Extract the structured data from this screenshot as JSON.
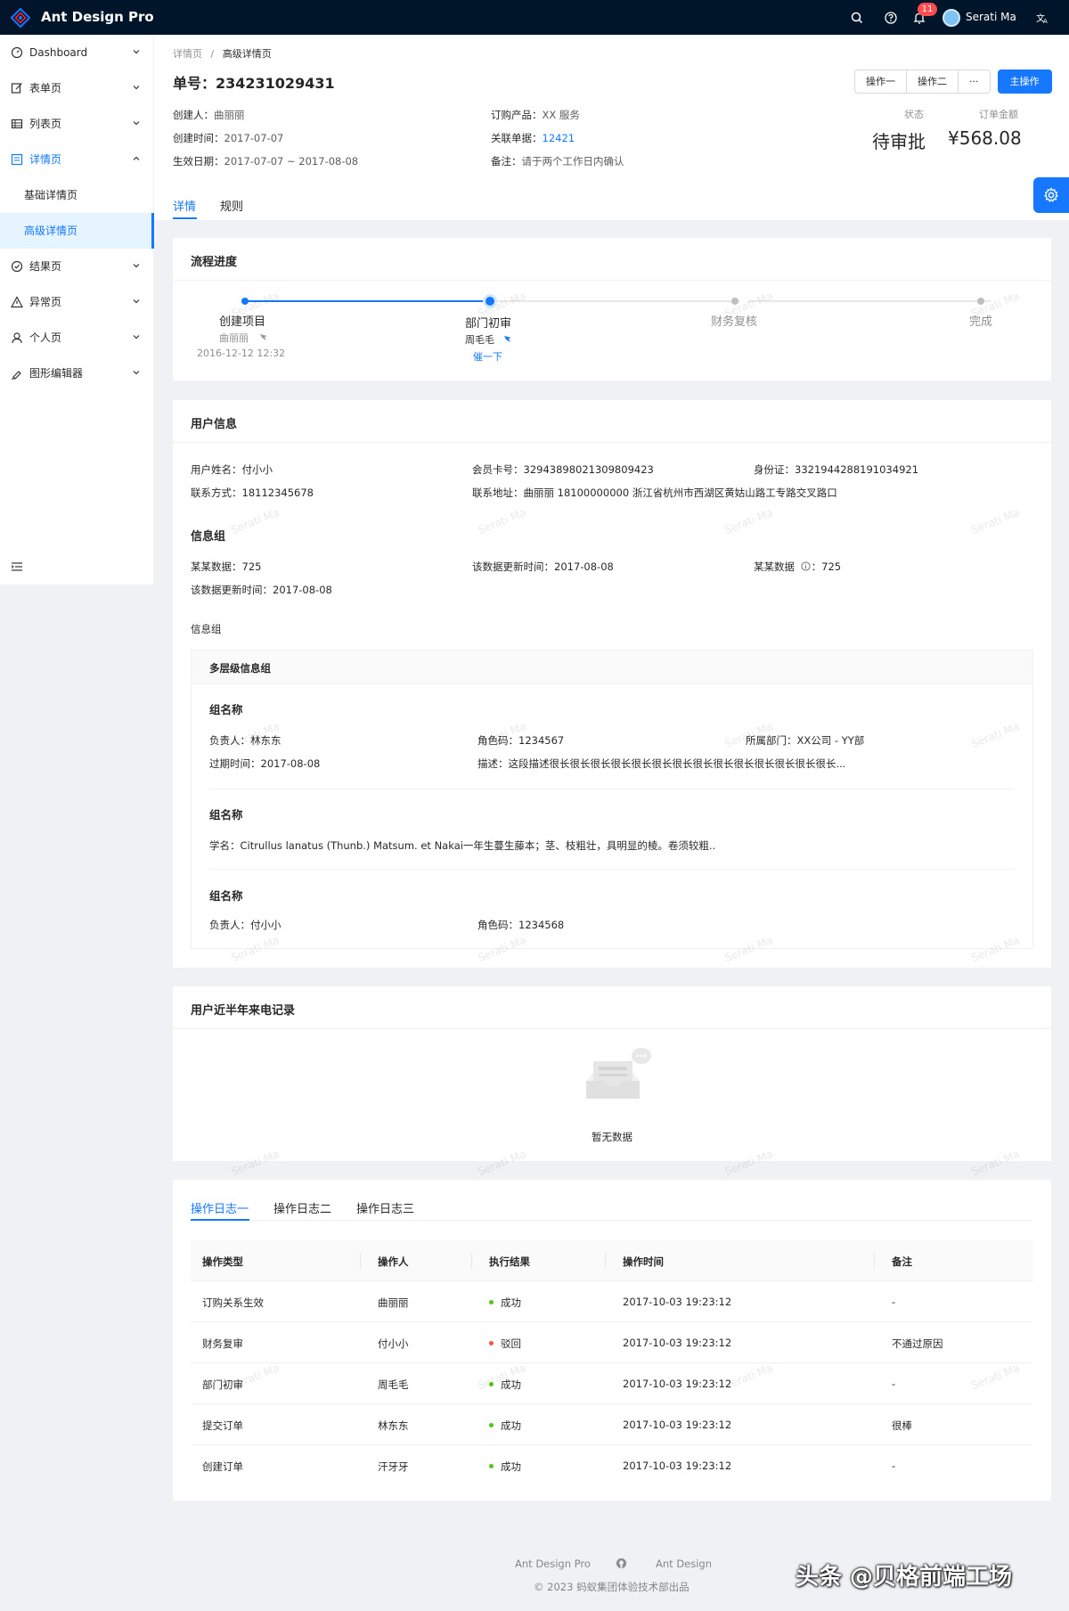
{
  "app": {
    "title": "Ant Design Pro"
  },
  "topbar": {
    "notification_count": "11",
    "username": "Serati Ma"
  },
  "sidebar": {
    "items": [
      {
        "label": "Dashboard"
      },
      {
        "label": "表单页"
      },
      {
        "label": "列表页"
      },
      {
        "label": "详情页"
      },
      {
        "label": "基础详情页"
      },
      {
        "label": "高级详情页"
      },
      {
        "label": "结果页"
      },
      {
        "label": "异常页"
      },
      {
        "label": "个人页"
      },
      {
        "label": "图形编辑器"
      }
    ]
  },
  "breadcrumb": {
    "parent": "详情页",
    "separator": "/",
    "current": "高级详情页"
  },
  "page": {
    "title": "单号：234231029431"
  },
  "actions": {
    "op1": "操作一",
    "op2": "操作二",
    "more": "···",
    "primary": "主操作"
  },
  "header_desc": {
    "creator_k": "创建人：",
    "creator_v": "曲丽丽",
    "product_k": "订购产品：",
    "product_v": "XX 服务",
    "created_k": "创建时间：",
    "created_v": "2017-07-07",
    "ref_k": "关联单据：",
    "ref_v": "12421",
    "effective_k": "生效日期：",
    "effective_v": "2017-07-07 ~ 2017-08-08",
    "note_k": "备注：",
    "note_v": "请于两个工作日内确认"
  },
  "stats": {
    "status_title": "状态",
    "status_value": "待审批",
    "amount_title": "订单金额",
    "amount_value": "¥568.08"
  },
  "tabs": {
    "detail": "详情",
    "rules": "规则"
  },
  "progress": {
    "title": "流程进度",
    "steps": [
      {
        "title": "创建项目",
        "person": "曲丽丽",
        "time": "2016-12-12 12:32"
      },
      {
        "title": "部门初审",
        "person": "周毛毛",
        "action": "催一下"
      },
      {
        "title": "财务复核"
      },
      {
        "title": "完成"
      }
    ]
  },
  "user_info": {
    "title": "用户信息",
    "name_k": "用户姓名：",
    "name_v": "付小小",
    "card_k": "会员卡号：",
    "card_v": "32943898021309809423",
    "id_k": "身份证：",
    "id_v": "3321944288191034921",
    "phone_k": "联系方式：",
    "phone_v": "18112345678",
    "addr_k": "联系地址：",
    "addr_v": "曲丽丽 18100000000 浙江省杭州市西湖区黄姑山路工专路交叉路口",
    "group_title": "信息组",
    "data1_k": "某某数据：",
    "data1_v": "725",
    "upd_k": "该数据更新时间：",
    "upd_v": "2017-08-08",
    "data2_k": "某某数据",
    "data2_v": "725",
    "upd2_k": "该数据更新时间：",
    "upd2_v": "2017-08-08",
    "group2_title": "信息组",
    "multi_title": "多层级信息组",
    "g1_title": "组名称",
    "g1_owner_k": "负责人：",
    "g1_owner_v": "林东东",
    "g1_role_k": "角色码：",
    "g1_role_v": "1234567",
    "g1_dept_k": "所属部门：",
    "g1_dept_v": "XX公司 - YY部",
    "g1_exp_k": "过期时间：",
    "g1_exp_v": "2017-08-08",
    "g1_desc_k": "描述：",
    "g1_desc_v": "这段描述很长很长很长很长很长很长很长很长很长很长很长很长很长很长...",
    "g2_title": "组名称",
    "g2_sci_k": "学名：",
    "g2_sci_v": "Citrullus lanatus (Thunb.) Matsum. et Nakai一年生蔓生藤本；茎、枝粗壮，具明显的棱。卷须较粗..",
    "g3_title": "组名称",
    "g3_owner_k": "负责人：",
    "g3_owner_v": "付小小",
    "g3_role_k": "角色码：",
    "g3_role_v": "1234568"
  },
  "calls": {
    "title": "用户近半年来电记录",
    "empty": "暂无数据"
  },
  "logs": {
    "tabs": [
      "操作日志一",
      "操作日志二",
      "操作日志三"
    ],
    "columns": [
      "操作类型",
      "操作人",
      "执行结果",
      "操作时间",
      "备注"
    ],
    "rows": [
      {
        "type": "订购关系生效",
        "op": "曲丽丽",
        "result": "成功",
        "status": "success",
        "time": "2017-10-03 19:23:12",
        "note": "-"
      },
      {
        "type": "财务复审",
        "op": "付小小",
        "result": "驳回",
        "status": "error",
        "time": "2017-10-03 19:23:12",
        "note": "不通过原因"
      },
      {
        "type": "部门初审",
        "op": "周毛毛",
        "result": "成功",
        "status": "success",
        "time": "2017-10-03 19:23:12",
        "note": "-"
      },
      {
        "type": "提交订单",
        "op": "林东东",
        "result": "成功",
        "status": "success",
        "time": "2017-10-03 19:23:12",
        "note": "很棒"
      },
      {
        "type": "创建订单",
        "op": "汗牙牙",
        "result": "成功",
        "status": "success",
        "time": "2017-10-03 19:23:12",
        "note": "-"
      }
    ]
  },
  "watermark": {
    "text": "Serati Ma"
  },
  "footer": {
    "link1": "Ant Design Pro",
    "link2": "Ant Design",
    "copyright": "© 2023 蚂蚁集团体验技术部出品"
  },
  "credit": {
    "text": "头条 @贝格前端工场"
  },
  "colors": {
    "primary": "#1677ff",
    "topbar": "#001529",
    "success": "#52c41a",
    "error": "#ff4d4f"
  }
}
